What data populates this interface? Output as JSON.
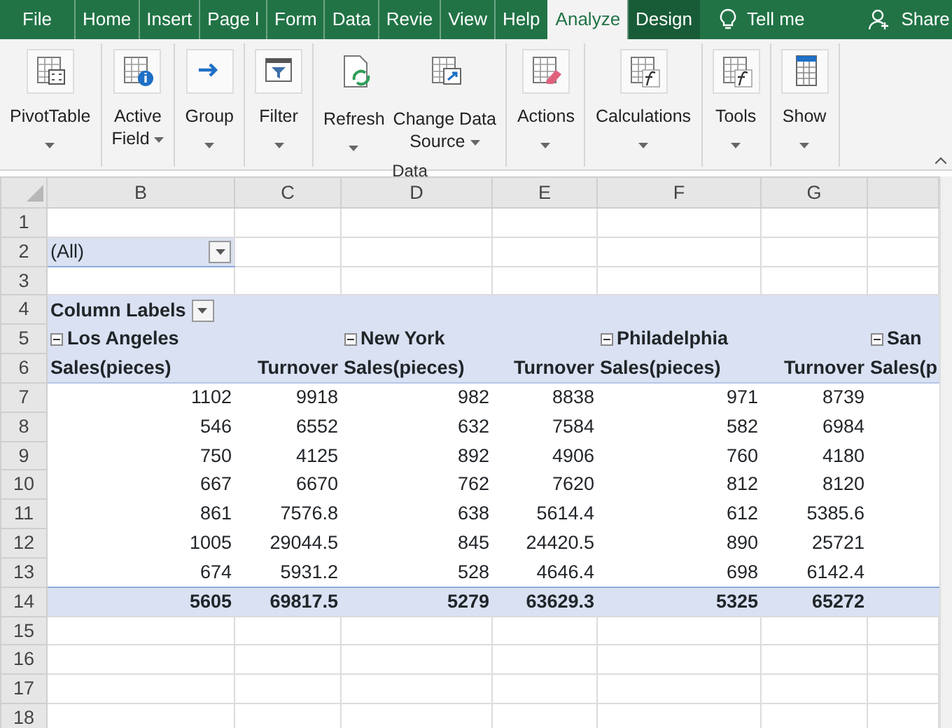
{
  "ribbon_tabs": [
    {
      "label": "File",
      "selected": false
    },
    {
      "label": "Home",
      "selected": false
    },
    {
      "label": "Insert",
      "selected": false
    },
    {
      "label": "Page l",
      "selected": false
    },
    {
      "label": "Form",
      "selected": false
    },
    {
      "label": "Data",
      "selected": false
    },
    {
      "label": "Revie",
      "selected": false
    },
    {
      "label": "View",
      "selected": false
    },
    {
      "label": "Help",
      "selected": false
    },
    {
      "label": "Analyze",
      "selected": true
    },
    {
      "label": "Design",
      "selected": false
    }
  ],
  "tell_me": "Tell me",
  "share": "Share",
  "ribbon_groups": [
    {
      "buttons": [
        {
          "lines": [
            "PivotTable"
          ]
        }
      ]
    },
    {
      "buttons": [
        {
          "lines": [
            "Active",
            "Field"
          ]
        }
      ]
    },
    {
      "buttons": [
        {
          "lines": [
            "Group"
          ]
        }
      ]
    },
    {
      "buttons": [
        {
          "lines": [
            "Filter"
          ]
        }
      ]
    },
    {
      "label": "Data",
      "buttons": [
        {
          "lines": [
            "Refresh"
          ]
        },
        {
          "lines": [
            "Change Data",
            "Source"
          ]
        }
      ]
    },
    {
      "buttons": [
        {
          "lines": [
            "Actions"
          ]
        }
      ]
    },
    {
      "buttons": [
        {
          "lines": [
            "Calculations"
          ]
        }
      ]
    },
    {
      "buttons": [
        {
          "lines": [
            "Tools"
          ]
        }
      ]
    },
    {
      "buttons": [
        {
          "lines": [
            "Show"
          ]
        }
      ]
    }
  ],
  "sheet": {
    "columns": [
      "B",
      "C",
      "D",
      "E",
      "F",
      "G"
    ],
    "rows": [
      {
        "number": "1",
        "kind": "empty"
      },
      {
        "number": "2",
        "kind": "filter",
        "value": "(All)"
      },
      {
        "number": "3",
        "kind": "empty"
      },
      {
        "number": "4",
        "kind": "labels",
        "value": "Column Labels"
      },
      {
        "number": "5",
        "kind": "groups",
        "groups": [
          "Los Angeles",
          "New York",
          "Philadelphia",
          "San"
        ]
      },
      {
        "number": "6",
        "kind": "fields",
        "cells": [
          "Sales(pieces)",
          "Turnover",
          "Sales(pieces)",
          "Turnover",
          "Sales(pieces)",
          "Turnover",
          "Sales(p"
        ]
      },
      {
        "number": "7",
        "kind": "data",
        "cells": [
          "1102",
          "9918",
          "982",
          "8838",
          "971",
          "8739"
        ]
      },
      {
        "number": "8",
        "kind": "data",
        "cells": [
          "546",
          "6552",
          "632",
          "7584",
          "582",
          "6984"
        ]
      },
      {
        "number": "9",
        "kind": "data",
        "cells": [
          "750",
          "4125",
          "892",
          "4906",
          "760",
          "4180"
        ]
      },
      {
        "number": "10",
        "kind": "data",
        "cells": [
          "667",
          "6670",
          "762",
          "7620",
          "812",
          "8120"
        ]
      },
      {
        "number": "11",
        "kind": "data",
        "cells": [
          "861",
          "7576.8",
          "638",
          "5614.4",
          "612",
          "5385.6"
        ]
      },
      {
        "number": "12",
        "kind": "data",
        "cells": [
          "1005",
          "29044.5",
          "845",
          "24420.5",
          "890",
          "25721"
        ]
      },
      {
        "number": "13",
        "kind": "data",
        "cells": [
          "674",
          "5931.2",
          "528",
          "4646.4",
          "698",
          "6142.4"
        ]
      },
      {
        "number": "14",
        "kind": "total",
        "cells": [
          "5605",
          "69817.5",
          "5279",
          "63629.3",
          "5325",
          "65272"
        ]
      },
      {
        "number": "15",
        "kind": "empty"
      },
      {
        "number": "16",
        "kind": "empty"
      },
      {
        "number": "17",
        "kind": "empty"
      },
      {
        "number": "18",
        "kind": "empty"
      }
    ]
  }
}
